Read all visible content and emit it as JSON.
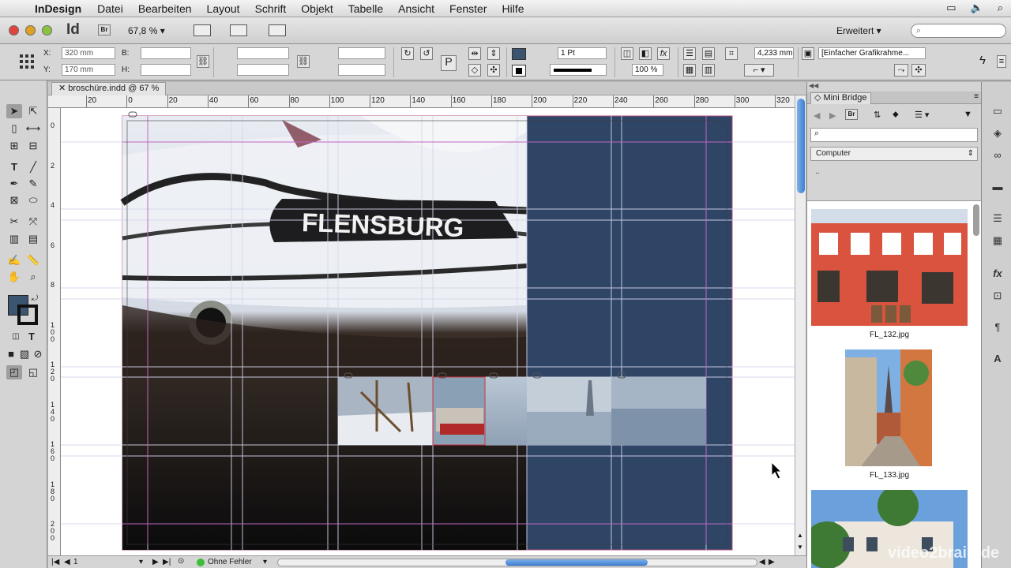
{
  "menubar": {
    "app": "InDesign",
    "items": [
      "Datei",
      "Bearbeiten",
      "Layout",
      "Schrift",
      "Objekt",
      "Tabelle",
      "Ansicht",
      "Fenster",
      "Hilfe"
    ]
  },
  "appbar": {
    "logo": "Id",
    "bridge_btn": "Br",
    "zoom": "67,8 %",
    "workspace": "Erweitert",
    "search_placeholder": ""
  },
  "control": {
    "x_label": "X:",
    "x_value": "320 mm",
    "y_label": "Y:",
    "y_value": "170 mm",
    "b_label": "B:",
    "h_label": "H:",
    "stroke_weight": "1 Pt",
    "opacity": "100 %",
    "offset": "4,233 mm",
    "frame_style": "[Einfacher Grafikrahme..."
  },
  "document": {
    "tab_title": "broschüre.indd @ 67 %",
    "ruler_h": [
      "20",
      "0",
      "20",
      "40",
      "60",
      "80",
      "100",
      "120",
      "140",
      "160",
      "180",
      "200",
      "220",
      "240",
      "260",
      "280",
      "300",
      "320"
    ],
    "ruler_v": [
      "0",
      "2",
      "4",
      "6",
      "8",
      "1\n0\n0",
      "1\n2\n0",
      "1\n4\n0",
      "1\n6\n0",
      "1\n8\n0",
      "2\n0\n0"
    ],
    "photo_text": "FLENSBURG",
    "accent_bg": "#2e4566"
  },
  "status": {
    "page": "1",
    "preflight": "Ohne Fehler"
  },
  "bridge": {
    "title": "Mini Bridge",
    "br_btn": "Br",
    "location": "Computer",
    "path": "..",
    "thumbnails": [
      "FL_132.jpg",
      "FL_133.jpg"
    ]
  },
  "watermark": "video2brain.de"
}
